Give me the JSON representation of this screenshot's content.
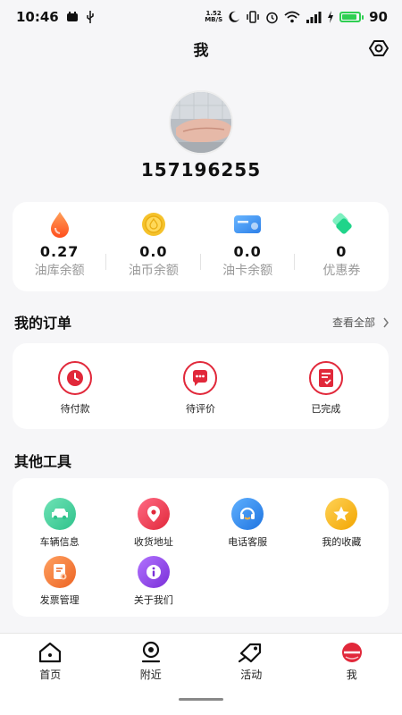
{
  "status_bar": {
    "time": "10:46",
    "net_speed_top": "1.52",
    "net_speed_bottom": "MB/S",
    "battery": "90",
    "battery_level": 0.9,
    "icons": [
      "notification-icon",
      "usb-icon",
      "moon-icon",
      "vibrate-icon",
      "alarm-icon",
      "wifi-icon",
      "signal-icon",
      "charging-icon"
    ]
  },
  "header": {
    "title": "我",
    "settings_icon": "settings-icon"
  },
  "profile": {
    "phone": "157196255"
  },
  "balances": [
    {
      "value": "0.27",
      "label": "油库余额",
      "icon": "oil-drop-icon",
      "color": "#ff6b2c"
    },
    {
      "value": "0.0",
      "label": "油币余额",
      "icon": "coin-icon",
      "color": "#f5c22b"
    },
    {
      "value": "0.0",
      "label": "油卡余额",
      "icon": "card-icon",
      "color": "#3d8ff0"
    },
    {
      "value": "0",
      "label": "优惠券",
      "icon": "coupon-icon",
      "color": "#2bd889"
    }
  ],
  "orders": {
    "title": "我的订单",
    "view_all": "查看全部",
    "items": [
      {
        "label": "待付款",
        "icon": "clock-icon"
      },
      {
        "label": "待评价",
        "icon": "chat-icon"
      },
      {
        "label": "已完成",
        "icon": "document-check-icon"
      }
    ]
  },
  "tools": {
    "title": "其他工具",
    "items": [
      {
        "label": "车辆信息",
        "icon": "car-icon",
        "color": "#3ccf9a"
      },
      {
        "label": "收货地址",
        "icon": "location-pin-icon",
        "color": "#f0385a"
      },
      {
        "label": "电话客服",
        "icon": "headset-icon",
        "color": "#2a86e8"
      },
      {
        "label": "我的收藏",
        "icon": "star-icon",
        "color": "#f7b51f"
      },
      {
        "label": "发票管理",
        "icon": "invoice-icon",
        "color": "#f27a34"
      },
      {
        "label": "关于我们",
        "icon": "info-icon",
        "color": "#8a3ee0"
      }
    ]
  },
  "bottom_nav": [
    {
      "label": "首页",
      "icon": "home-icon"
    },
    {
      "label": "附近",
      "icon": "nearby-icon"
    },
    {
      "label": "活动",
      "icon": "tag-icon"
    },
    {
      "label": "我",
      "icon": "profile-icon",
      "active": true
    }
  ],
  "colors": {
    "accent": "#e1283a",
    "background": "#f6f6f8",
    "card": "#ffffff"
  }
}
